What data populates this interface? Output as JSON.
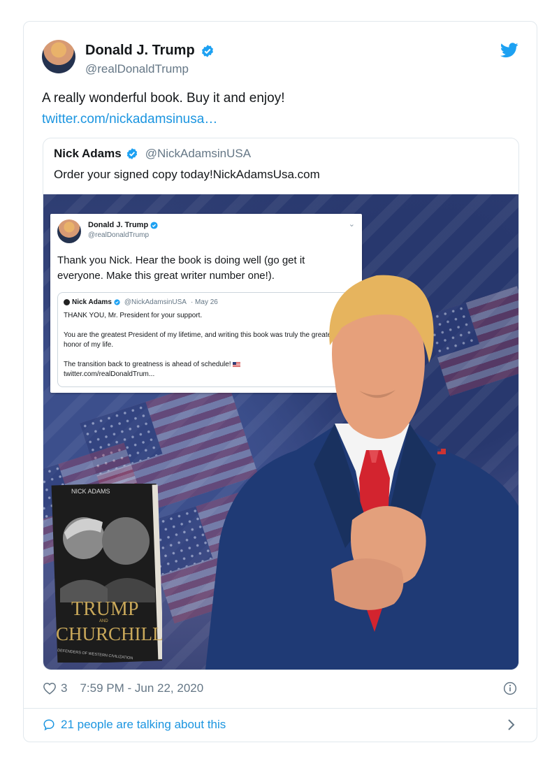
{
  "tweet": {
    "author_name": "Donald J. Trump",
    "author_handle": "@realDonaldTrump",
    "text": "A really wonderful book. Buy it and enjoy!",
    "link": "twitter.com/nickadamsinusa…",
    "likes": "3",
    "timestamp": "7:59 PM - Jun 22, 2020",
    "talking": "21 people are talking about this",
    "colors": {
      "link": "#1b95e0",
      "verified": "#1da1f2",
      "secondary": "#657786"
    }
  },
  "quoted": {
    "author_name": "Nick Adams",
    "author_handle": "@NickAdamsinUSA",
    "text": "Order your signed copy today!NickAdamsUsa.com"
  },
  "media": {
    "inner_tweet": {
      "author_name": "Donald J. Trump",
      "author_handle": "@realDonaldTrump",
      "text": "Thank you Nick. Hear the book is doing well (go get it everyone. Make this great writer number one!).",
      "quote": {
        "author_name": "Nick Adams",
        "author_handle": "@NickAdamsinUSA",
        "date": "· May 26",
        "line1": "THANK YOU, Mr. President for your support.",
        "line2": "You are the greatest President of my lifetime, and writing this book was truly the greatest honor of my life.",
        "line3": "The transition back to greatness is ahead of schedule!",
        "line4": "twitter.com/realDonaldTrum..."
      }
    },
    "book": {
      "author": "NICK ADAMS",
      "title_top": "TRUMP",
      "title_and": "AND",
      "title_bottom": "CHURCHILL",
      "subtitle": "DEFENDERS OF WESTERN CIVILIZATION"
    }
  }
}
